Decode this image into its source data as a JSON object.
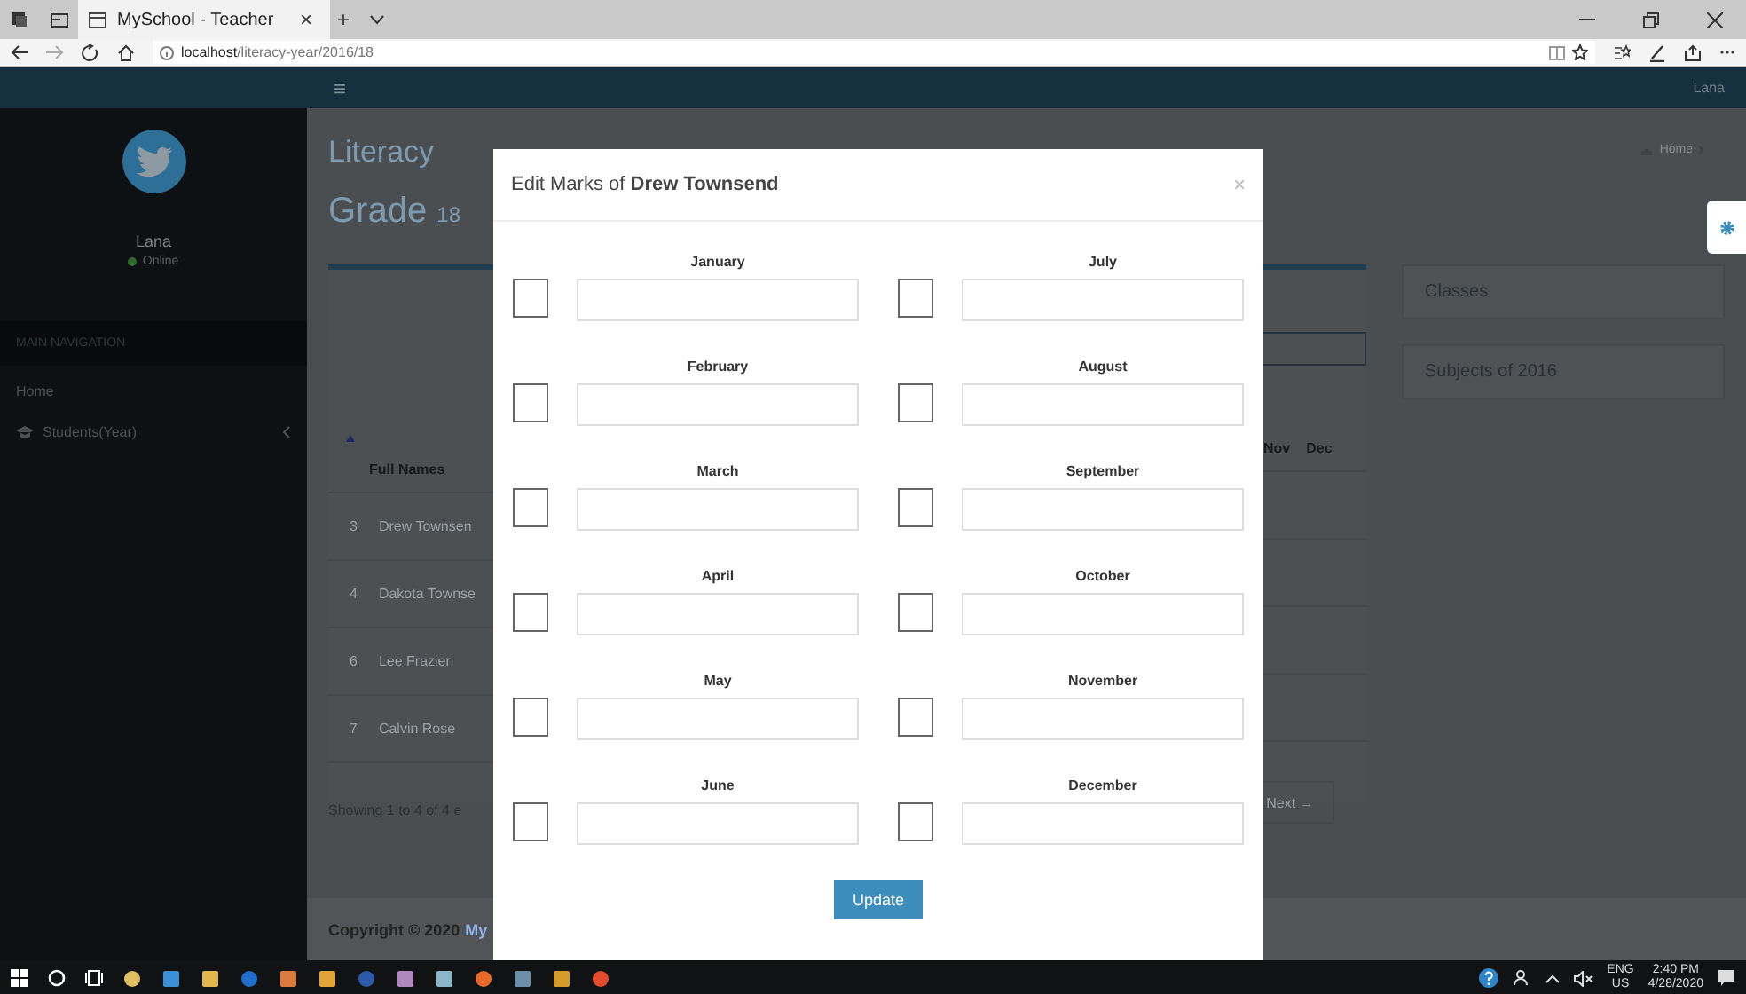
{
  "browser": {
    "tab_title": "MySchool - Teacher",
    "tab_close": "×",
    "new_tab": "+",
    "url_host": "localhost",
    "url_path": "/literacy-year/2016/18"
  },
  "navbar": {
    "menu": "≡",
    "user": "Lana"
  },
  "sidebar": {
    "user_name": "Lana",
    "status": "Online",
    "section": "MAIN NAVIGATION",
    "items": [
      {
        "label": "Home"
      },
      {
        "label": "Students(Year)",
        "expanded": false
      }
    ]
  },
  "page": {
    "title": "Literacy",
    "subtitle": "Grade",
    "grade": "18",
    "breadcrumb": "Home"
  },
  "table": {
    "columns_left": [
      "Full Names"
    ],
    "columns_right": [
      "Nov",
      "Dec"
    ],
    "rows": [
      {
        "number": "3",
        "name": "Drew Townsen"
      },
      {
        "number": "4",
        "name": "Dakota Townse"
      },
      {
        "number": "6",
        "name": "Lee Frazier"
      },
      {
        "number": "7",
        "name": "Calvin Rose"
      }
    ],
    "info": "Showing 1 to 4 of 4 e",
    "next": "Next →"
  },
  "side_panels": [
    "Classes",
    "Subjects of 2016"
  ],
  "footer": {
    "copyright": "Copyright © 2020",
    "link": "My"
  },
  "modal": {
    "title": "Edit Marks of **Drew Townsend**",
    "close": "×",
    "months": [
      {
        "label": "January",
        "checked": false
      },
      {
        "label": "February",
        "checked": false
      },
      {
        "label": "March",
        "checked": false
      },
      {
        "label": "April",
        "checked": false
      },
      {
        "label": "May",
        "checked": false
      },
      {
        "label": "June",
        "checked": false
      },
      {
        "label": "July",
        "checked": false
      },
      {
        "label": "August",
        "checked": false
      },
      {
        "label": "September",
        "checked": false
      },
      {
        "label": "October",
        "checked": false
      },
      {
        "label": "November",
        "checked": false
      },
      {
        "label": "December",
        "checked": false
      }
    ],
    "button": "Update"
  },
  "taskbar": {
    "language": "ENG",
    "region": "US",
    "time": "2:40 PM",
    "date": "4/28/2020"
  }
}
